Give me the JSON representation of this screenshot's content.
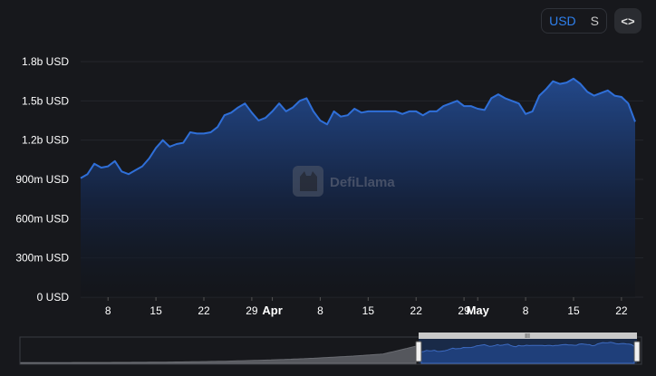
{
  "controls": {
    "currency_options": [
      "USD",
      "S"
    ],
    "selected": "USD",
    "embed_label": "<>"
  },
  "watermark": "DefiLlama",
  "brush_handle_label": "III",
  "chart_data": {
    "type": "area",
    "ylabel": "",
    "xlabel": "",
    "ylim": [
      0,
      1800000000
    ],
    "y_ticks": [
      "0 USD",
      "300m USD",
      "600m USD",
      "900m USD",
      "1.2b USD",
      "1.5b USD",
      "1.8b USD"
    ],
    "x_ticks": [
      {
        "label": "8",
        "date": "2025-03-08",
        "bold": false
      },
      {
        "label": "15",
        "date": "2025-03-15",
        "bold": false
      },
      {
        "label": "22",
        "date": "2025-03-22",
        "bold": false
      },
      {
        "label": "29",
        "date": "2025-03-29",
        "bold": false
      },
      {
        "label": "Apr",
        "date": "2025-04-01",
        "bold": true
      },
      {
        "label": "8",
        "date": "2025-04-08",
        "bold": false
      },
      {
        "label": "15",
        "date": "2025-04-15",
        "bold": false
      },
      {
        "label": "22",
        "date": "2025-04-22",
        "bold": false
      },
      {
        "label": "29",
        "date": "2025-04-29",
        "bold": false
      },
      {
        "label": "May",
        "date": "2025-05-01",
        "bold": true
      },
      {
        "label": "8",
        "date": "2025-05-08",
        "bold": false
      },
      {
        "label": "15",
        "date": "2025-05-15",
        "bold": false
      },
      {
        "label": "22",
        "date": "2025-05-22",
        "bold": false
      }
    ],
    "x": [
      "2025-03-04",
      "2025-03-05",
      "2025-03-06",
      "2025-03-07",
      "2025-03-08",
      "2025-03-09",
      "2025-03-10",
      "2025-03-11",
      "2025-03-12",
      "2025-03-13",
      "2025-03-14",
      "2025-03-15",
      "2025-03-16",
      "2025-03-17",
      "2025-03-18",
      "2025-03-19",
      "2025-03-20",
      "2025-03-21",
      "2025-03-22",
      "2025-03-23",
      "2025-03-24",
      "2025-03-25",
      "2025-03-26",
      "2025-03-27",
      "2025-03-28",
      "2025-03-29",
      "2025-03-30",
      "2025-03-31",
      "2025-04-01",
      "2025-04-02",
      "2025-04-03",
      "2025-04-04",
      "2025-04-05",
      "2025-04-06",
      "2025-04-07",
      "2025-04-08",
      "2025-04-09",
      "2025-04-10",
      "2025-04-11",
      "2025-04-12",
      "2025-04-13",
      "2025-04-14",
      "2025-04-15",
      "2025-04-16",
      "2025-04-17",
      "2025-04-18",
      "2025-04-19",
      "2025-04-20",
      "2025-04-21",
      "2025-04-22",
      "2025-04-23",
      "2025-04-24",
      "2025-04-25",
      "2025-04-26",
      "2025-04-27",
      "2025-04-28",
      "2025-04-29",
      "2025-04-30",
      "2025-05-01",
      "2025-05-02",
      "2025-05-03",
      "2025-05-04",
      "2025-05-05",
      "2025-05-06",
      "2025-05-07",
      "2025-05-08",
      "2025-05-09",
      "2025-05-10",
      "2025-05-11",
      "2025-05-12",
      "2025-05-13",
      "2025-05-14",
      "2025-05-15",
      "2025-05-16",
      "2025-05-17",
      "2025-05-18",
      "2025-05-19",
      "2025-05-20",
      "2025-05-21",
      "2025-05-22",
      "2025-05-23",
      "2025-05-24"
    ],
    "series": [
      {
        "name": "",
        "color": "#2f6fd8",
        "values": [
          910000000,
          940000000,
          1020000000,
          990000000,
          1000000000,
          1040000000,
          960000000,
          940000000,
          970000000,
          1000000000,
          1060000000,
          1140000000,
          1200000000,
          1150000000,
          1170000000,
          1180000000,
          1260000000,
          1250000000,
          1250000000,
          1260000000,
          1300000000,
          1390000000,
          1410000000,
          1450000000,
          1480000000,
          1410000000,
          1350000000,
          1370000000,
          1420000000,
          1480000000,
          1420000000,
          1450000000,
          1500000000,
          1520000000,
          1420000000,
          1350000000,
          1320000000,
          1420000000,
          1380000000,
          1390000000,
          1440000000,
          1410000000,
          1420000000,
          1420000000,
          1420000000,
          1420000000,
          1420000000,
          1400000000,
          1420000000,
          1420000000,
          1390000000,
          1420000000,
          1420000000,
          1460000000,
          1480000000,
          1500000000,
          1460000000,
          1460000000,
          1440000000,
          1430000000,
          1520000000,
          1550000000,
          1520000000,
          1500000000,
          1480000000,
          1400000000,
          1420000000,
          1540000000,
          1590000000,
          1650000000,
          1630000000,
          1640000000,
          1670000000,
          1630000000,
          1570000000,
          1540000000,
          1560000000,
          1580000000,
          1540000000,
          1530000000,
          1480000000,
          1340000000
        ]
      }
    ]
  }
}
